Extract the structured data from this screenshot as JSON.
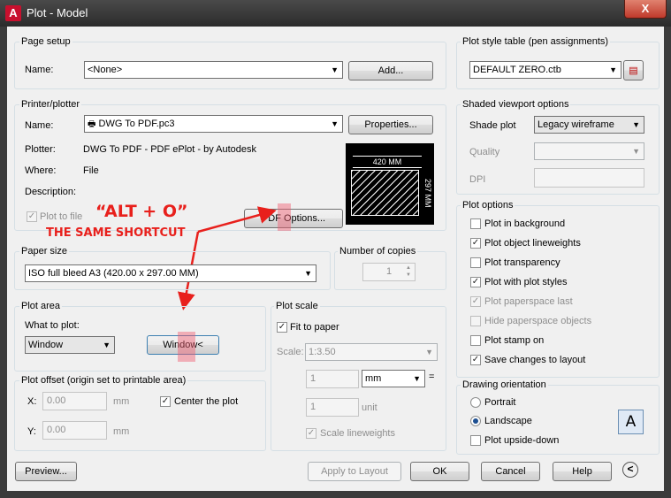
{
  "window": {
    "title": "Plot - Model",
    "app_icon": "A",
    "close_glyph": "X"
  },
  "page_setup": {
    "group_label": "Page setup",
    "name_label": "Name:",
    "name_value": "<None>",
    "add_label": "Add..."
  },
  "printer": {
    "group_label": "Printer/plotter",
    "name_label": "Name:",
    "name_value": "DWG To PDF.pc3",
    "properties_label": "Properties...",
    "plotter_label": "Plotter:",
    "plotter_value": "DWG To PDF - PDF ePlot - by Autodesk",
    "where_label": "Where:",
    "where_value": "File",
    "description_label": "Description:",
    "plot_to_file_label": "Plot to file",
    "pdf_options_label": "PDF Options...",
    "preview_width": "420 MM",
    "preview_height": "297 MM"
  },
  "annotation": {
    "alt": "“ALT + O”",
    "same": "THE SAME SHORTCUT",
    "color": "#e8201c"
  },
  "paper_size": {
    "group_label": "Paper size",
    "value": "ISO full bleed A3 (420.00 x 297.00 MM)"
  },
  "copies": {
    "group_label": "Number of copies",
    "value": "1"
  },
  "plot_area": {
    "group_label": "Plot area",
    "what_label": "What to plot:",
    "what_value": "Window",
    "window_button": "Window<"
  },
  "plot_offset": {
    "group_label": "Plot offset (origin set to printable area)",
    "x_label": "X:",
    "x_value": "0.00",
    "x_unit": "mm",
    "y_label": "Y:",
    "y_value": "0.00",
    "y_unit": "mm",
    "center_label": "Center the plot"
  },
  "plot_scale": {
    "group_label": "Plot scale",
    "fit_label": "Fit to paper",
    "scale_label": "Scale:",
    "scale_value": "1:3.50",
    "num_value": "1",
    "unit_select": "mm",
    "equals": "=",
    "den_value": "1",
    "unit_label": "unit",
    "lineweights_label": "Scale lineweights"
  },
  "plot_style": {
    "group_label": "Plot style table (pen assignments)",
    "value": "DEFAULT ZERO.ctb"
  },
  "shaded": {
    "group_label": "Shaded viewport options",
    "shade_label": "Shade plot",
    "shade_value": "Legacy wireframe",
    "quality_label": "Quality",
    "dpi_label": "DPI"
  },
  "plot_options": {
    "group_label": "Plot options",
    "items": [
      {
        "label": "Plot in background",
        "checked": false,
        "disabled": false
      },
      {
        "label": "Plot object lineweights",
        "checked": true,
        "disabled": false
      },
      {
        "label": "Plot transparency",
        "checked": false,
        "disabled": false
      },
      {
        "label": "Plot with plot styles",
        "checked": true,
        "disabled": false
      },
      {
        "label": "Plot paperspace last",
        "checked": true,
        "disabled": true
      },
      {
        "label": "Hide paperspace objects",
        "checked": false,
        "disabled": true
      },
      {
        "label": "Plot stamp on",
        "checked": false,
        "disabled": false
      },
      {
        "label": "Save changes to layout",
        "checked": true,
        "disabled": false
      }
    ]
  },
  "orientation": {
    "group_label": "Drawing orientation",
    "portrait": "Portrait",
    "landscape": "Landscape",
    "upside_down": "Plot upside-down",
    "orient_glyph": "A"
  },
  "footer": {
    "preview": "Preview...",
    "apply": "Apply to Layout",
    "ok": "OK",
    "cancel": "Cancel",
    "help": "Help",
    "collapse_glyph": "<"
  },
  "icons": {
    "printer": "printer-icon",
    "edit": "edit-plot-style-icon",
    "collapse": "collapse-icon"
  }
}
